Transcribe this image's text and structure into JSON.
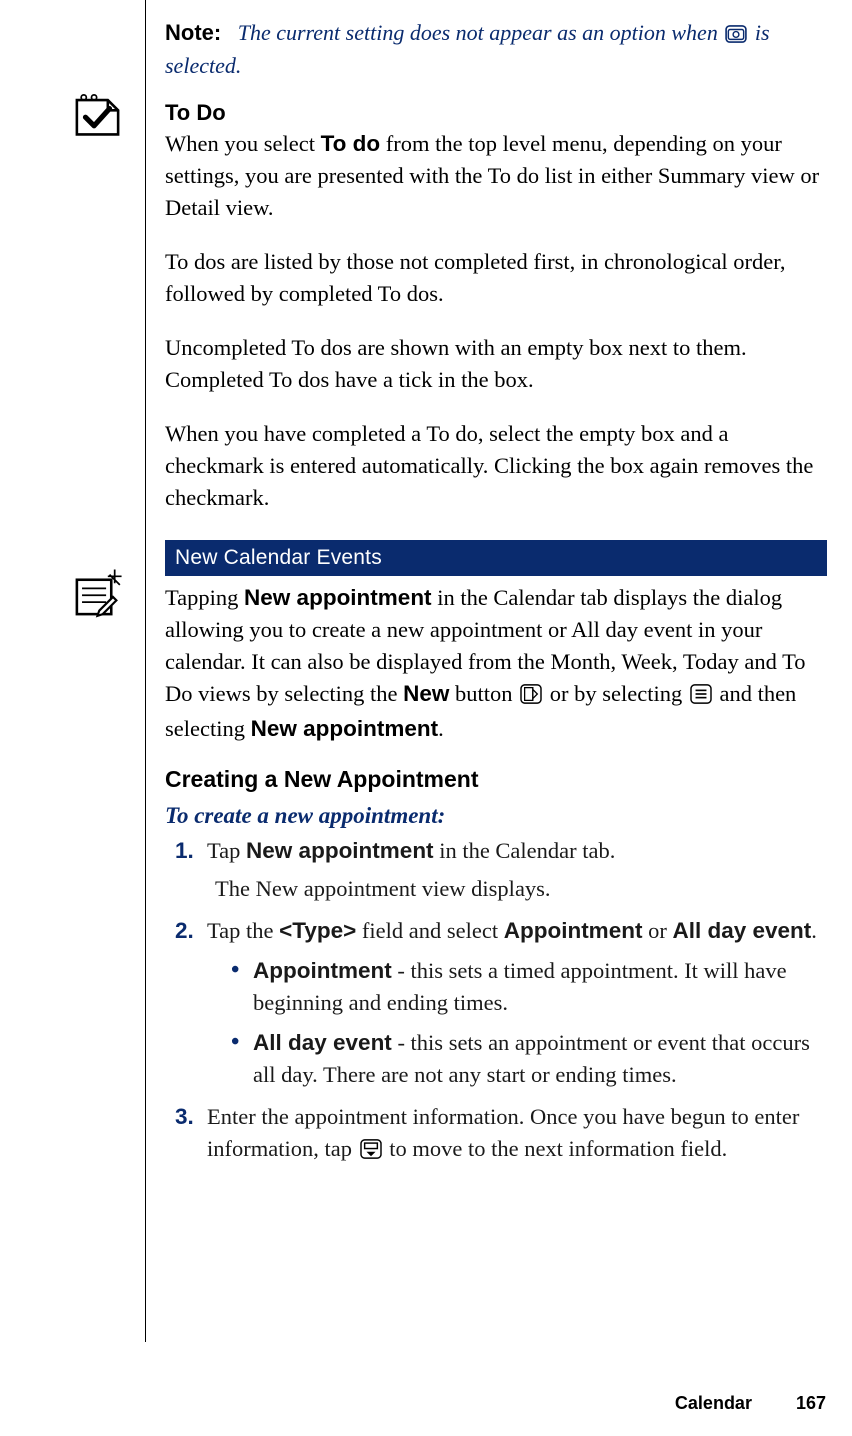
{
  "note": {
    "label": "Note:",
    "body_pre": "The current setting does not appear as an option when ",
    "body_post": " is selected."
  },
  "todo": {
    "heading": "To Do",
    "p1_pre": "When you select ",
    "p1_bold": "To do",
    "p1_post": " from the top level menu, depending on your settings, you are presented with the To do list in either Summary view or Detail view.",
    "p2": "To dos are listed by those not completed first, in chronological order, followed by completed To dos.",
    "p3": "Uncompleted To dos are shown with an empty box next to them. Completed To dos have a tick in the box.",
    "p4": "When you have completed a To do, select the empty box and a checkmark is entered automatically. Clicking the box again removes the checkmark."
  },
  "section": {
    "title": "New Calendar Events",
    "intro": {
      "pre": "Tapping ",
      "b1": "New appointment",
      "mid1": " in the Calendar tab displays the dialog allowing you to create a new appointment or All day event in your calendar. It can also be displayed from the Month, Week, Today and To Do views by selecting the ",
      "b2": "New",
      "mid2": " button ",
      "mid3": " or by selecting ",
      "mid4": " and then selecting ",
      "b3": "New appointment",
      "end": "."
    }
  },
  "create": {
    "heading": "Creating a New Appointment",
    "procedure_title": "To create a new appointment:",
    "steps": {
      "s1": {
        "pre": "Tap ",
        "b": "New appointment",
        "post": " in the Calendar tab."
      },
      "s1_sub": "The New appointment view displays.",
      "s2": {
        "pre": "Tap the ",
        "b1": "<Type>",
        "mid": " field and select ",
        "b2": "Appointment",
        "or": " or ",
        "b3": "All day event",
        "end": "."
      },
      "s2_bullets": {
        "b1": {
          "label": "Appointment",
          "text": " - this sets a timed appointment. It will have beginning and ending times."
        },
        "b2": {
          "label": "All day event",
          "text": " - this sets an appointment or event that occurs all day. There are not any start or ending times."
        }
      },
      "s3": {
        "pre": "Enter the appointment information. Once you have begun to enter information, tap ",
        "post": " to move to the next information field."
      }
    }
  },
  "footer": {
    "section": "Calendar",
    "page": "167"
  },
  "icons": {
    "camera": "camera-icon",
    "new": "new-page-icon",
    "menu": "menu-icon",
    "nav": "nav-down-icon",
    "margin_check": "checkbox-tag-icon",
    "margin_note": "note-pad-icon"
  }
}
